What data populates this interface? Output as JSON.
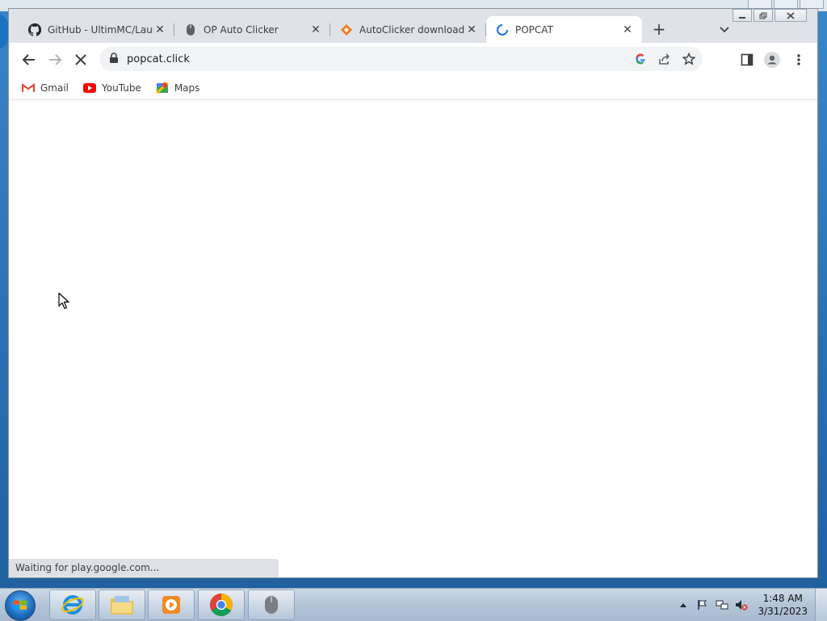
{
  "browser": {
    "tabs": [
      {
        "title": "GitHub - UltimMC/Launcher",
        "icon": "github-icon",
        "active": false
      },
      {
        "title": "OP Auto Clicker",
        "icon": "mouse-icon",
        "active": false
      },
      {
        "title": "AutoClicker download | SourceForge",
        "icon": "sourceforge-icon",
        "active": false
      },
      {
        "title": "POPCAT",
        "icon": "loading-spinner-icon",
        "active": true
      }
    ],
    "new_tab_symbol": "+",
    "close_symbol": "✕",
    "url": "popcat.click",
    "bookmarks": [
      {
        "label": "Gmail",
        "icon": "gmail-icon"
      },
      {
        "label": "YouTube",
        "icon": "youtube-icon"
      },
      {
        "label": "Maps",
        "icon": "maps-icon"
      }
    ],
    "status_text": "Waiting for play.google.com..."
  },
  "taskbar": {
    "clock_time": "1:48 AM",
    "clock_date": "3/31/2023",
    "apps": [
      "internet-explorer-icon",
      "file-explorer-icon",
      "media-player-icon",
      "chrome-icon",
      "auto-clicker-icon"
    ]
  },
  "colors": {
    "gmail_red": "#ea4335",
    "youtube_red": "#ff0000",
    "spinner_blue": "#1a73e8"
  }
}
